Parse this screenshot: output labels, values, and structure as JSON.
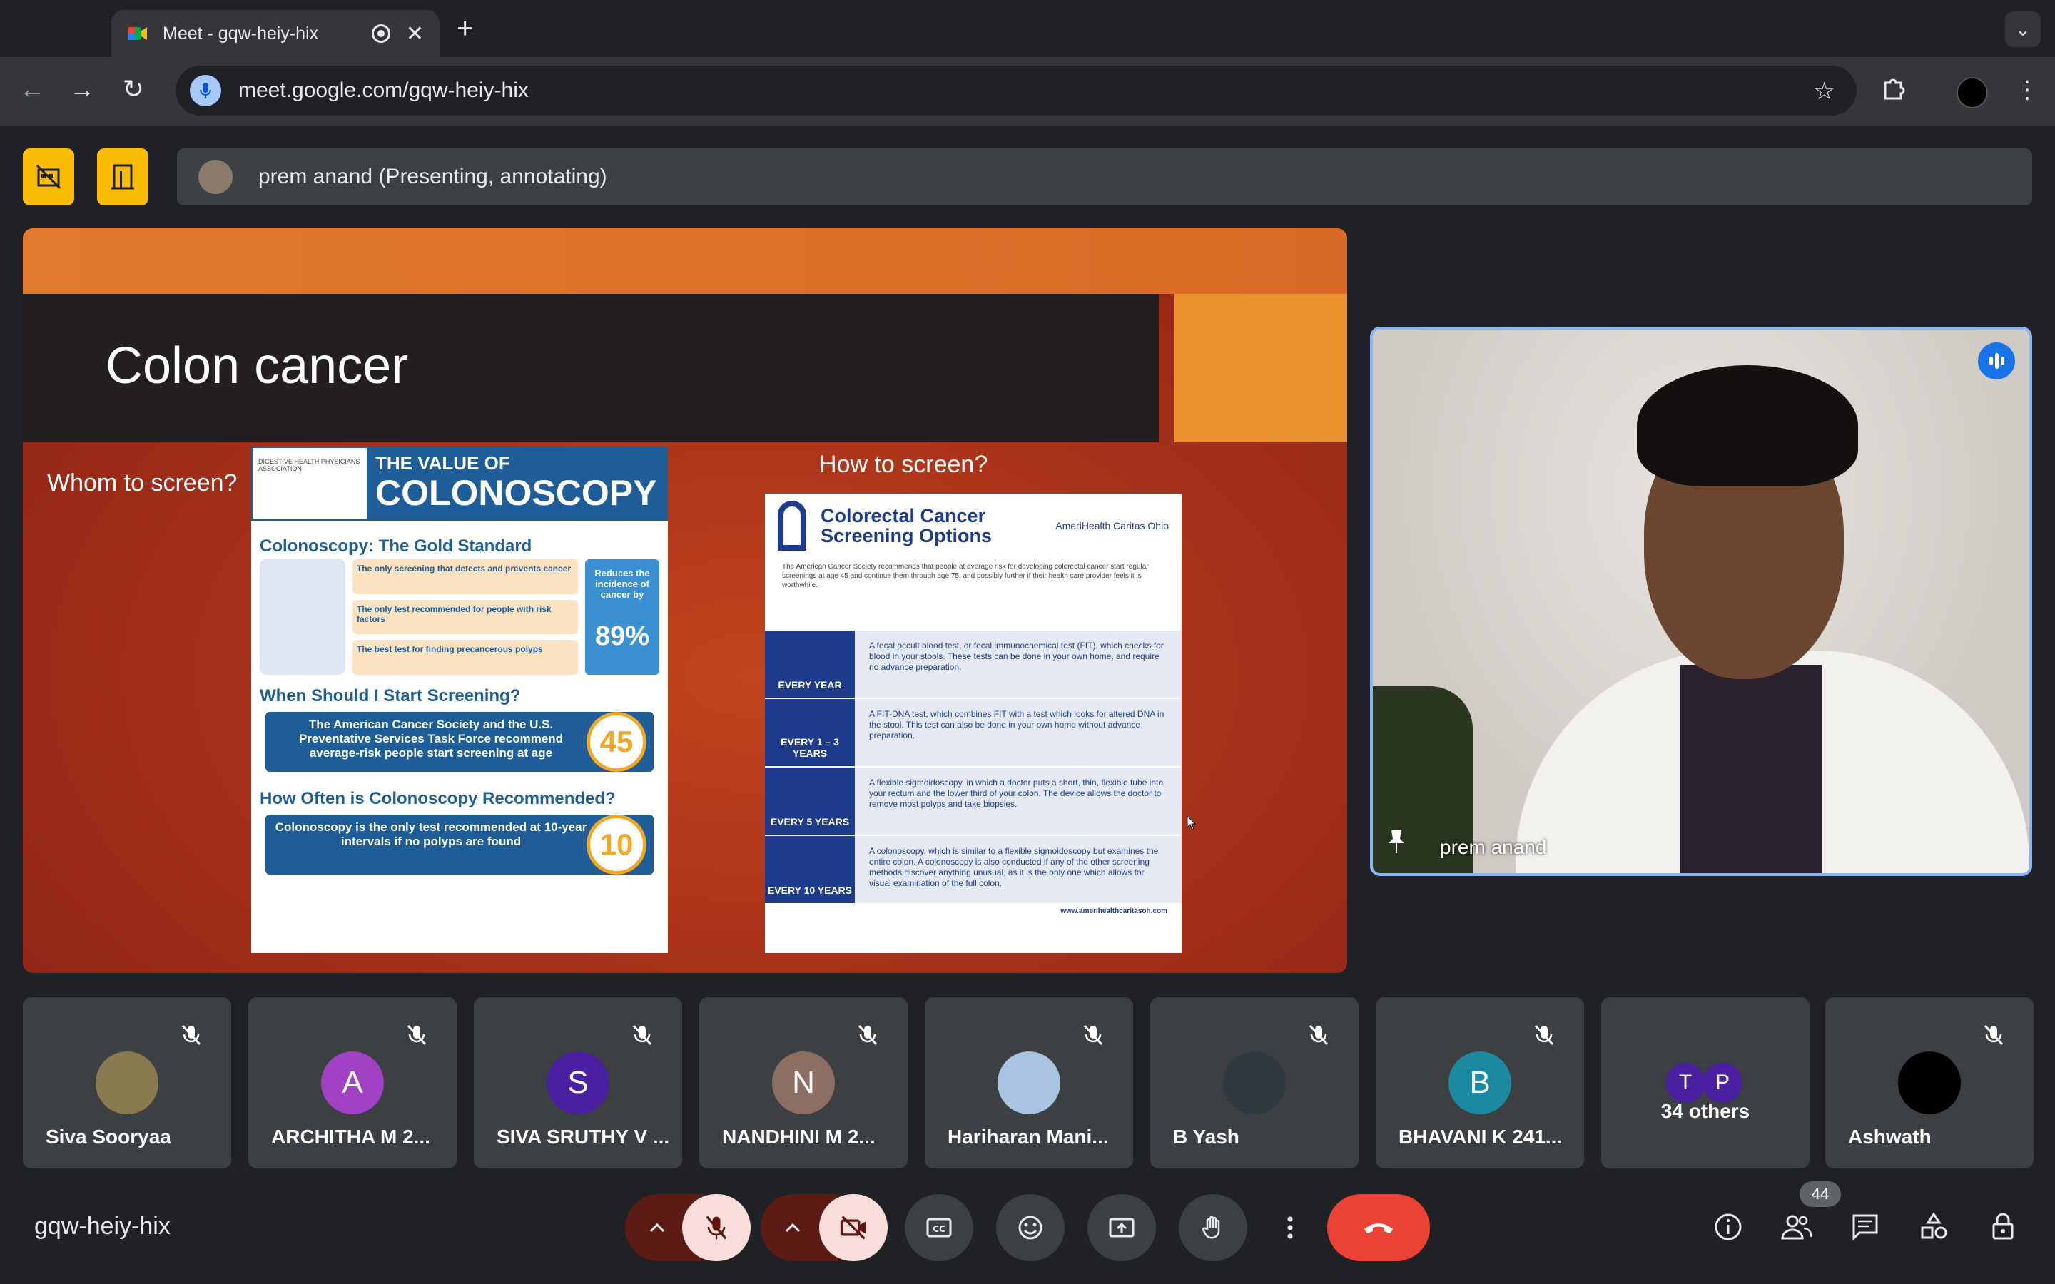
{
  "browser": {
    "tab_title": "Meet - gqw-heiy-hix",
    "new_tab_symbol": "+",
    "url": "meet.google.com/gqw-heiy-hix"
  },
  "meet": {
    "presenter_banner": "prem anand (Presenting, annotating)",
    "meeting_code": "gqw-heiy-hix",
    "participant_count_badge": "44"
  },
  "slide": {
    "title": "Colon cancer",
    "question_left": "Whom to screen?",
    "question_right": "How to screen?",
    "poster_left": {
      "header_small": "THE VALUE OF",
      "header_big": "COLONOSCOPY",
      "section1": "Colonoscopy: The Gold Standard",
      "gold_line1": "The only screening that detects and prevents cancer",
      "gold_line2": "The only test recommended for people with risk factors",
      "gold_line3": "The best test for finding precancerous polyps",
      "reduces_text": "Reduces the incidence of cancer by",
      "reduces_value": "89%",
      "section2": "When Should I Start Screening?",
      "start_text": "The American Cancer Society and the U.S. Preventative Services Task Force recommend average-risk people start screening at age",
      "start_value": "45",
      "section3": "How Often is Colonoscopy Recommended?",
      "often_text": "Colonoscopy is the only test recommended at 10-year intervals if no polyps are found",
      "often_value": "10"
    },
    "poster_right": {
      "title": "Colorectal Cancer Screening Options",
      "brand": "AmeriHealth Caritas Ohio",
      "intro": "The American Cancer Society recommends that people at average risk for developing colorectal cancer start regular screenings at age 45 and continue them through age 75, and possibly further if their health care provider feels it is worthwhile.",
      "rows": [
        {
          "label": "EVERY YEAR",
          "text": "A fecal occult blood test, or fecal immunochemical test (FIT), which checks for blood in your stools. These tests can be done in your own home, and require no advance preparation."
        },
        {
          "label": "EVERY 1 – 3 YEARS",
          "text": "A FIT-DNA test, which combines FIT with a test which looks for altered DNA in the stool. This test can also be done in your own home without advance preparation."
        },
        {
          "label": "EVERY 5 YEARS",
          "text": "A flexible sigmoidoscopy, in which a doctor puts a short, thin, flexible tube into your rectum and the lower third of your colon. The device allows the doctor to remove most polyps and take biopsies."
        },
        {
          "label": "EVERY 10 YEARS",
          "text": "A colonoscopy, which is similar to a flexible sigmoidoscopy but examines the entire colon. A colonoscopy is also conducted if any of the other screening methods discover anything unusual, as it is the only one which allows for visual examination of the full colon."
        }
      ],
      "footer_url": "www.amerihealthcaritasoh.com"
    }
  },
  "speaker": {
    "name": "prem anand"
  },
  "participants": [
    {
      "name": "Siva Sooryaa",
      "initial": "",
      "color": "#8a7a50"
    },
    {
      "name": "ARCHITHA M 2...",
      "initial": "A",
      "color": "#a142c4"
    },
    {
      "name": "SIVA SRUTHY V ...",
      "initial": "S",
      "color": "#4a1fa0"
    },
    {
      "name": "NANDHINI M 2...",
      "initial": "N",
      "color": "#8d6e63"
    },
    {
      "name": "Hariharan Mani...",
      "initial": "",
      "color": "#a9c4e0"
    },
    {
      "name": "B Yash",
      "initial": "",
      "color": "#2f3a40"
    },
    {
      "name": "BHAVANI K 241...",
      "initial": "B",
      "color": "#1b8aa0"
    },
    {
      "name": "Ashwath",
      "initial": "",
      "color": "#000000"
    }
  ],
  "others_tile": {
    "label": "34 others",
    "initials": [
      "T",
      "P"
    ]
  },
  "colors": {
    "end_call": "#ea4335",
    "muted_btn": "#f9dedc",
    "accent_yellow": "#fbbc04",
    "active_speaker": "#8ab4f8"
  }
}
